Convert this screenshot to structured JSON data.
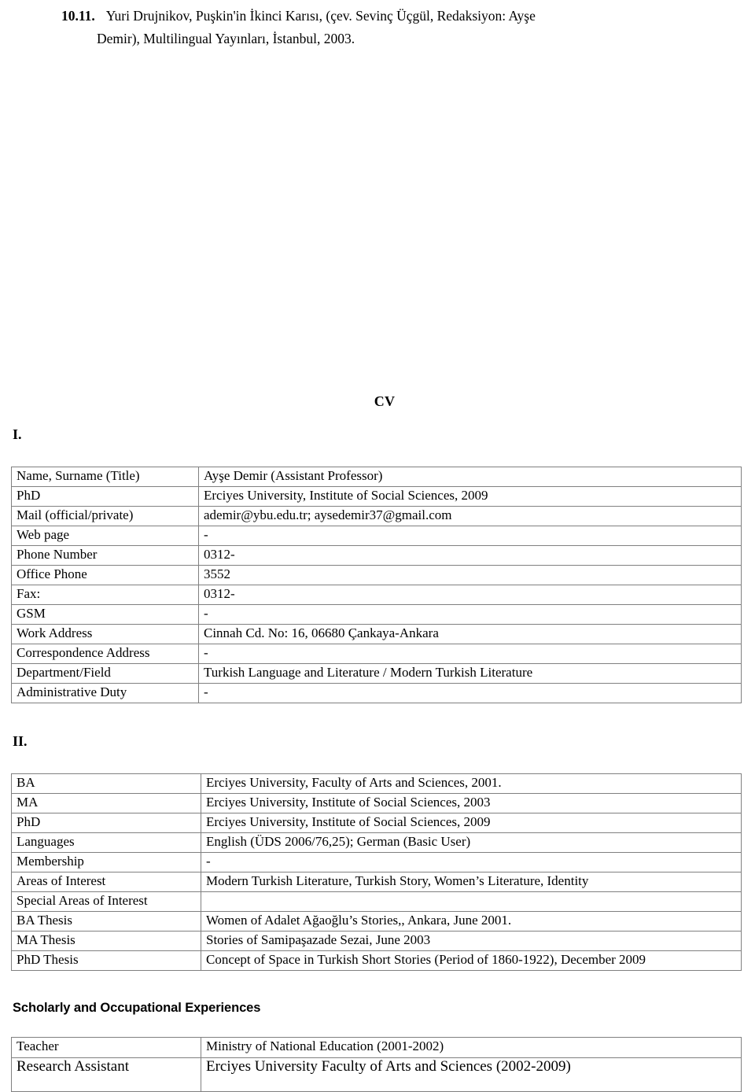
{
  "citation": {
    "number": "10.11.",
    "line1": "Yuri Drujnikov, Puşkin'in İkinci Karısı, (çev. Sevinç Üçgül, Redaksiyon: Ayşe",
    "line2": "Demir), Multilingual Yayınları, İstanbul, 2003."
  },
  "cv_title": "CV",
  "sections": {
    "one_marker": "I.",
    "two_marker": "II.",
    "experiences_heading": "Scholarly and Occupational Experiences"
  },
  "personal_table": {
    "rows": [
      {
        "label": "Name, Surname (Title)",
        "value": "Ayşe Demir (Assistant Professor)"
      },
      {
        "label": "PhD",
        "value": "Erciyes University, Institute of Social Sciences, 2009"
      },
      {
        "label": "Mail (official/private)",
        "value": "ademir@ybu.edu.tr; aysedemir37@gmail.com"
      },
      {
        "label": "Web page",
        "value": "-"
      },
      {
        "label": "Phone Number",
        "value": "0312-"
      },
      {
        "label": "Office Phone",
        "value": "3552"
      },
      {
        "label": "Fax:",
        "value": "0312-"
      },
      {
        "label": "GSM",
        "value": "-"
      },
      {
        "label": "Work Address",
        "value": "Cinnah Cd. No: 16, 06680 Çankaya-Ankara"
      },
      {
        "label": "Correspondence Address",
        "value": "-"
      },
      {
        "label": "Department/Field",
        "value": "Turkish Language and Literature / Modern Turkish Literature"
      },
      {
        "label": "Administrative Duty",
        "value": "-"
      }
    ]
  },
  "education_table": {
    "rows": [
      {
        "label": "BA",
        "value": "Erciyes University, Faculty of Arts and Sciences, 2001."
      },
      {
        "label": "MA",
        "value": "Erciyes University, Institute of Social Sciences, 2003"
      },
      {
        "label": "PhD",
        "value": "Erciyes University, Institute of Social Sciences, 2009"
      },
      {
        "label": "Languages",
        "value": "English (ÜDS 2006/76,25); German (Basic User)"
      },
      {
        "label": "Membership",
        "value": "-"
      },
      {
        "label": "Areas of Interest",
        "value": "Modern Turkish Literature, Turkish Story, Women’s Literature, Identity"
      },
      {
        "label": "Special Areas of Interest",
        "value": ""
      },
      {
        "label": "BA Thesis",
        "value": "Women of Adalet Ağaoğlu’s Stories,, Ankara, June 2001."
      },
      {
        "label": "MA Thesis",
        "value": "Stories of Samipaşazade Sezai, June 2003"
      },
      {
        "label": "PhD Thesis",
        "value": "Concept of Space in Turkish Short Stories (Period of 1860-1922), December 2009"
      }
    ]
  },
  "experience_table": {
    "rows": [
      {
        "label": "Teacher",
        "value": "Ministry of National Education (2001-2002)"
      },
      {
        "label": "Research Assistant",
        "value": "Erciyes University Faculty of Arts and Sciences (2002-2009)"
      }
    ]
  }
}
